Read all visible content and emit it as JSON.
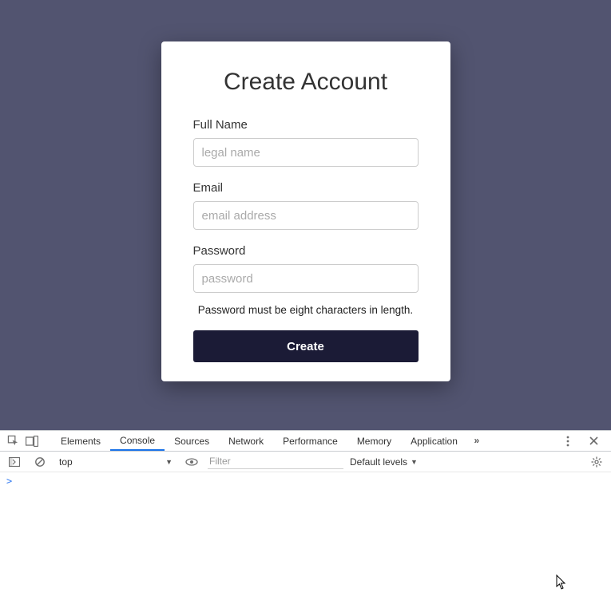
{
  "form": {
    "title": "Create Account",
    "fullName": {
      "label": "Full Name",
      "placeholder": "legal name",
      "value": ""
    },
    "email": {
      "label": "Email",
      "placeholder": "email address",
      "value": ""
    },
    "password": {
      "label": "Password",
      "placeholder": "password",
      "value": ""
    },
    "hint": "Password must be eight characters in length.",
    "submit": "Create"
  },
  "devtools": {
    "tabs": {
      "elements": "Elements",
      "console": "Console",
      "sources": "Sources",
      "network": "Network",
      "performance": "Performance",
      "memory": "Memory",
      "application": "Application"
    },
    "activeTab": "Console",
    "toolbar": {
      "context": "top",
      "filterPlaceholder": "Filter",
      "levels": "Default levels"
    },
    "prompt": ">"
  }
}
